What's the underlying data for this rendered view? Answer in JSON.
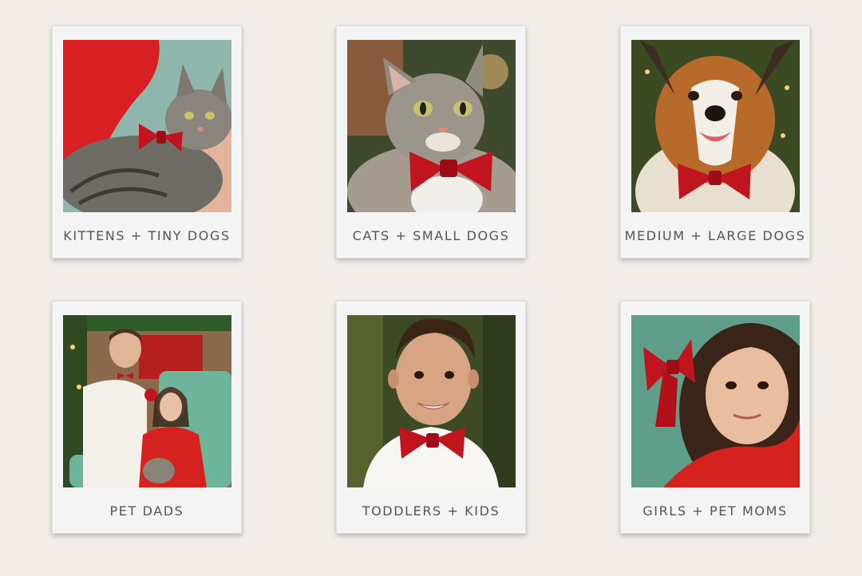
{
  "cards": [
    {
      "caption": "KITTENS + TINY DOGS"
    },
    {
      "caption": "CATS + SMALL DOGS"
    },
    {
      "caption": "MEDIUM + LARGE DOGS"
    },
    {
      "caption": "PET DADS"
    },
    {
      "caption": "TODDLERS + KIDS"
    },
    {
      "caption": "GIRLS + PET MOMS"
    }
  ],
  "colors": {
    "background": "#f2ede8",
    "bow_red": "#c0141f",
    "caption_text": "#555555"
  }
}
